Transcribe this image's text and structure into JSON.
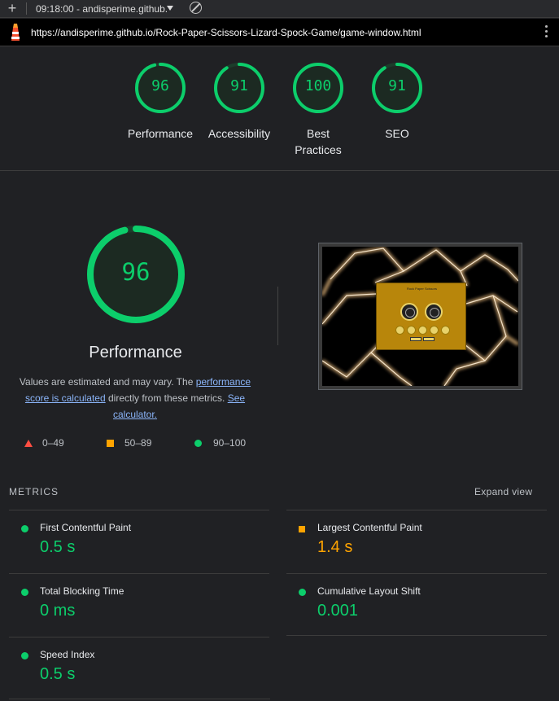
{
  "toolbar": {
    "session_label": "09:18:00 - andisperime.github.",
    "new_icon": "plus-icon",
    "clear_icon": "clear-icon"
  },
  "urlbar": {
    "url": "https://andisperime.github.io/Rock-Paper-Scissors-Lizard-Spock-Game/game-window.html",
    "logo_icon": "lighthouse-logo-icon",
    "menu_icon": "more-vert-icon"
  },
  "scores": [
    {
      "label": "Performance",
      "value": "96",
      "fraction": 0.96
    },
    {
      "label": "Accessibility",
      "value": "91",
      "fraction": 0.91
    },
    {
      "label": "Best\nPractices",
      "value": "100",
      "fraction": 1.0
    },
    {
      "label": "SEO",
      "value": "91",
      "fraction": 0.91
    }
  ],
  "performance": {
    "score": "96",
    "fraction": 0.96,
    "title": "Performance",
    "desc_prefix": "Values are estimated and may vary. The ",
    "desc_link1": "performance score is calculated",
    "desc_mid": " directly from these metrics. ",
    "desc_link2": "See calculator.",
    "legend": [
      {
        "range": "0–49",
        "icon": "triangle-red-icon"
      },
      {
        "range": "50–89",
        "icon": "square-orange-icon"
      },
      {
        "range": "90–100",
        "icon": "circle-green-icon"
      }
    ],
    "screenshot_title": "Rock Paper Scissors"
  },
  "metrics": {
    "heading": "METRICS",
    "expand_label": "Expand view",
    "items": [
      {
        "name": "First Contentful Paint",
        "value": "0.5 s",
        "status": "pass"
      },
      {
        "name": "Largest Contentful Paint",
        "value": "1.4 s",
        "status": "average"
      },
      {
        "name": "Total Blocking Time",
        "value": "0 ms",
        "status": "pass"
      },
      {
        "name": "Cumulative Layout Shift",
        "value": "0.001",
        "status": "pass"
      },
      {
        "name": "Speed Index",
        "value": "0.5 s",
        "status": "pass"
      }
    ]
  },
  "colors": {
    "pass": "#0cce6b",
    "average": "#ffa400",
    "fail": "#ff4e42",
    "background": "#202124"
  }
}
